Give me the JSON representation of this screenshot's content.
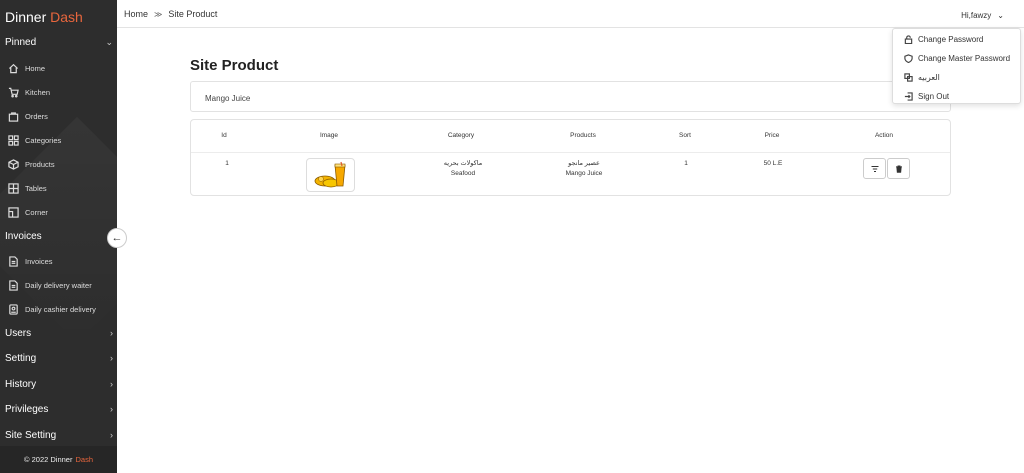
{
  "brand": {
    "name": "Dinner",
    "accent": "Dash"
  },
  "sidebar": {
    "pinned_label": "Pinned",
    "pinned_items": [
      {
        "label": "Home",
        "icon": "home-icon"
      },
      {
        "label": "Kitchen",
        "icon": "cart-icon"
      },
      {
        "label": "Orders",
        "icon": "bag-icon"
      },
      {
        "label": "Categories",
        "icon": "grid-icon"
      },
      {
        "label": "Products",
        "icon": "box-icon"
      },
      {
        "label": "Tables",
        "icon": "table-icon"
      },
      {
        "label": "Corner",
        "icon": "corner-icon"
      }
    ],
    "invoices_label": "Invoices",
    "invoice_items": [
      {
        "label": "Invoices",
        "icon": "file-icon"
      },
      {
        "label": "Daily delivery waiter",
        "icon": "file-icon"
      },
      {
        "label": "Daily cashier delivery",
        "icon": "badge-icon"
      }
    ],
    "groups": [
      "Users",
      "Setting",
      "History",
      "Privileges",
      "Site Setting"
    ],
    "footer_text": "© 2022 Dinner",
    "footer_accent": "Dash"
  },
  "breadcrumb": {
    "home": "Home",
    "separator": "≫",
    "current": "Site Product"
  },
  "user": {
    "greeting": "Hi,fawzy"
  },
  "dropdown": {
    "items": [
      {
        "label": "Change Password",
        "icon": "lock-icon"
      },
      {
        "label": "Change Master Password",
        "icon": "shield-icon"
      },
      {
        "label": "العربيه",
        "icon": "translate-icon"
      },
      {
        "label": "Sign Out",
        "icon": "sign-out-icon"
      }
    ]
  },
  "page": {
    "title": "Site Product",
    "product_name": "Mango Juice"
  },
  "table": {
    "headers": [
      "Id",
      "Image",
      "Category",
      "Products",
      "Sort",
      "Price",
      "Action"
    ],
    "rows": [
      {
        "id": "1",
        "category_ar": "ماكولات بحريه",
        "category_en": "Seafood",
        "product_ar": "عصير مانجو",
        "product_en": "Mango Juice",
        "sort": "1",
        "price": "50 L.E"
      }
    ]
  },
  "colors": {
    "accent": "#e8663d",
    "sidebar_bg": "#2d2d2d"
  }
}
